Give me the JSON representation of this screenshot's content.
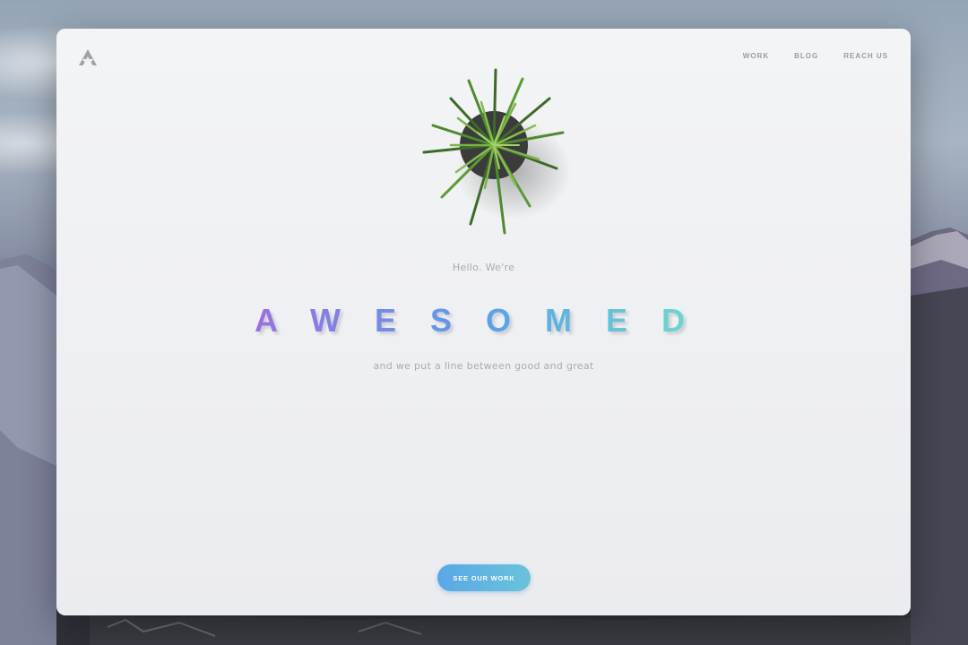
{
  "nav": {
    "items": [
      {
        "label": "WORK"
      },
      {
        "label": "BLOG"
      },
      {
        "label": "REACH US"
      }
    ]
  },
  "hero": {
    "greeting": "Hello. We're",
    "brand": "AWESOMED",
    "tagline": "and we put a line between good and great"
  },
  "cta": {
    "label": "SEE OUR WORK"
  },
  "icons": {
    "logo": "a-logo-icon",
    "plant": "succulent-plant-illustration"
  },
  "colors": {
    "gradient_start": "#9b6fe2",
    "gradient_mid": "#5aa0ea",
    "gradient_end": "#6ee0c9",
    "cta_start": "#5aa8e6",
    "cta_end": "#69c3db",
    "nav_text": "#9a9ca3",
    "muted_text": "#a9abb2"
  }
}
